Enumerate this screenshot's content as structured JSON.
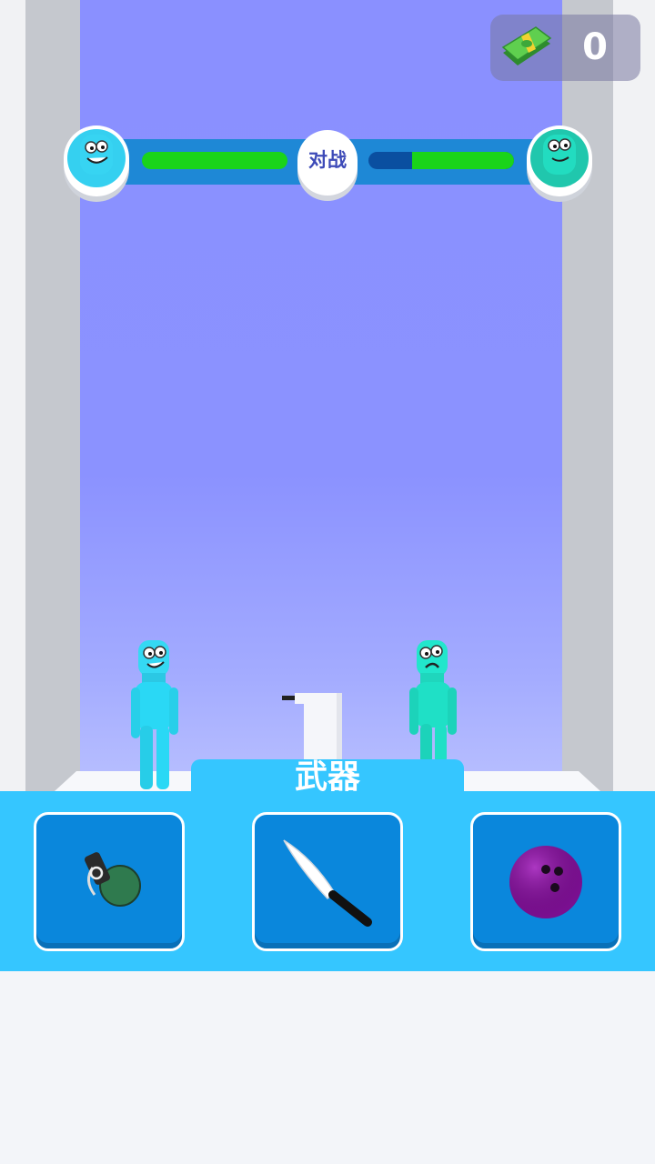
{
  "hud": {
    "currency_value": "0",
    "currency_icon": "cash-stack-icon",
    "vs_label": "对战",
    "player_health_fraction": 1.0,
    "enemy_health_fraction": 0.7
  },
  "weapons_panel": {
    "title": "武器",
    "slots": [
      {
        "icon": "grenade-icon"
      },
      {
        "icon": "knife-icon"
      },
      {
        "icon": "bowling-ball-icon"
      }
    ]
  },
  "colors": {
    "backdrop": "#8a90ff",
    "health_green": "#1ad41a",
    "panel_blue": "#35c6ff",
    "slot_blue": "#0a87dc",
    "player_cyan": "#2ad8f5",
    "enemy_teal": "#1fe0c6"
  }
}
